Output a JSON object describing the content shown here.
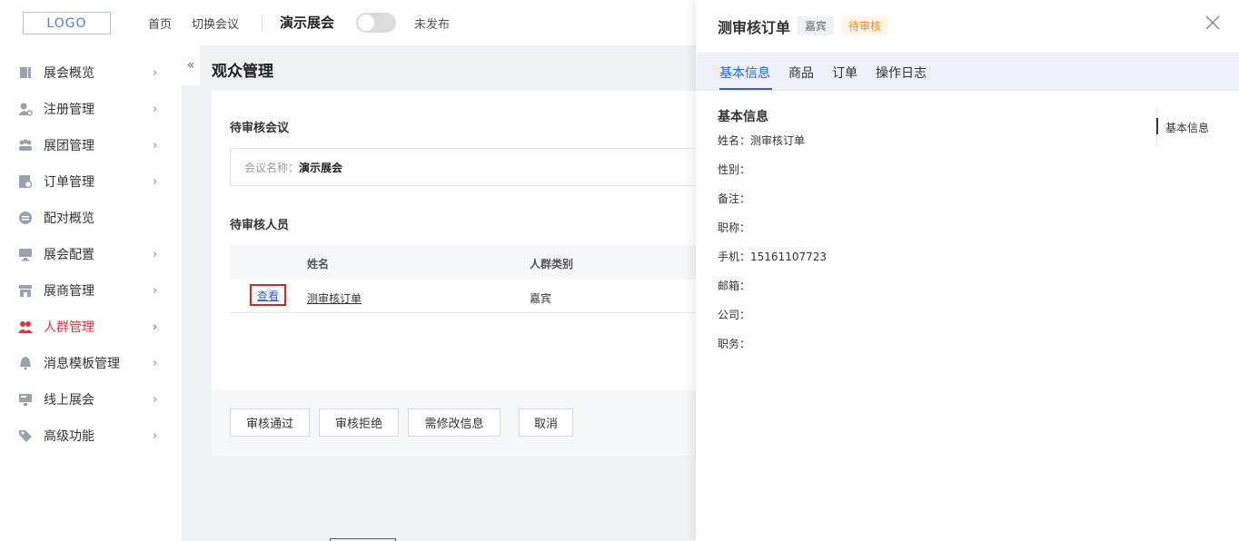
{
  "header": {
    "logo": "LOGO",
    "nav_home": "首页",
    "nav_switch": "切换会议",
    "expo_name": "演示展会",
    "publish_status": "未发布"
  },
  "sidebar": {
    "collapse": "«",
    "items": [
      {
        "label": "展会概览",
        "icon": "document-icon",
        "arrow": "›"
      },
      {
        "label": "注册管理",
        "icon": "user-gear-icon",
        "arrow": "›"
      },
      {
        "label": "展团管理",
        "icon": "group-icon",
        "arrow": "›"
      },
      {
        "label": "订单管理",
        "icon": "order-icon",
        "arrow": "›"
      },
      {
        "label": "配对概览",
        "icon": "pair-icon",
        "arrow": ""
      },
      {
        "label": "展会配置",
        "icon": "monitor-icon",
        "arrow": "›"
      },
      {
        "label": "展商管理",
        "icon": "store-icon",
        "arrow": "›"
      },
      {
        "label": "人群管理",
        "icon": "people-icon",
        "arrow": "›",
        "active": true
      },
      {
        "label": "消息模板管理",
        "icon": "bell-icon",
        "arrow": "›"
      },
      {
        "label": "线上展会",
        "icon": "screen-icon",
        "arrow": "›"
      },
      {
        "label": "高级功能",
        "icon": "tag-icon",
        "arrow": "›"
      }
    ]
  },
  "main": {
    "page_title": "观众管理",
    "pending_meeting_title": "待审核会议",
    "meeting_label": "会议名称：",
    "meeting_value": "演示展会",
    "pending_people_title": "待审核人员",
    "table": {
      "headers": [
        "姓名",
        "人群类别"
      ],
      "rows": [
        {
          "action": "查看",
          "name": "测审核订单",
          "type": "嘉宾"
        }
      ]
    },
    "buttons": {
      "approve": "审核通过",
      "reject": "审核拒绝",
      "need_modify": "需修改信息",
      "cancel": "取消"
    }
  },
  "drawer": {
    "title": "测审核订单",
    "tag_type": "嘉宾",
    "tag_status": "待审核",
    "tabs": [
      "基本信息",
      "商品",
      "订单",
      "操作日志"
    ],
    "section_heading": "基本信息",
    "anchor": "基本信息",
    "fields": [
      {
        "label": "姓名：",
        "value": "测审核订单"
      },
      {
        "label": "性别：",
        "value": ""
      },
      {
        "label": "备注：",
        "value": ""
      },
      {
        "label": "职称：",
        "value": ""
      },
      {
        "label": "手机：",
        "value": "15161107723"
      },
      {
        "label": "邮箱：",
        "value": ""
      },
      {
        "label": "公司：",
        "value": ""
      },
      {
        "label": "职务：",
        "value": ""
      }
    ]
  },
  "colors": {
    "accent_blue": "#2f5fd6",
    "active_red": "#e0343a",
    "pending_orange": "#f08a24"
  }
}
